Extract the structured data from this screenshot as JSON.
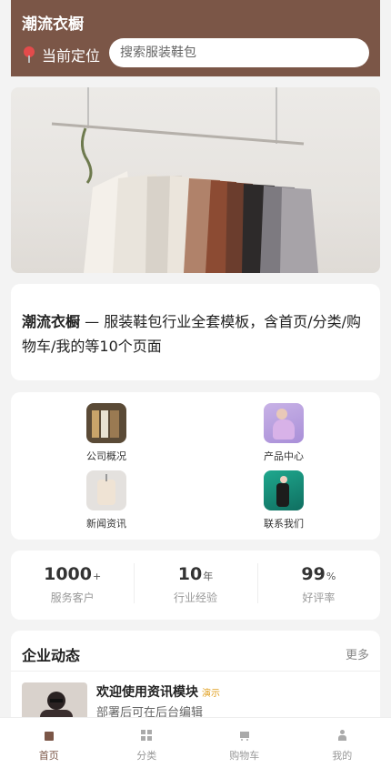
{
  "header": {
    "brand": "潮流衣橱",
    "location_label": "当前定位",
    "search_placeholder": "搜索服装鞋包"
  },
  "intro": {
    "brand": "潮流衣橱",
    "text": " — 服装鞋包行业全套模板，含首页/分类/购物车/我的等10个页面"
  },
  "grid": [
    {
      "label": "公司概况",
      "icon": "clothes-rack-icon"
    },
    {
      "label": "产品中心",
      "icon": "fashion-model-icon"
    },
    {
      "label": "新闻资讯",
      "icon": "blouse-icon"
    },
    {
      "label": "联系我们",
      "icon": "dancer-icon"
    }
  ],
  "stats": [
    {
      "value": "1000",
      "unit": "+",
      "label": "服务客户"
    },
    {
      "value": "10",
      "unit": "年",
      "label": "行业经验"
    },
    {
      "value": "99",
      "unit": "%",
      "label": "好评率"
    }
  ],
  "news": {
    "title": "企业动态",
    "more": "更多",
    "item": {
      "title": "欢迎使用资讯模块",
      "tag": "演示",
      "desc": "部署后可在后台编辑"
    }
  },
  "tabbar": [
    {
      "label": "首页",
      "active": true
    },
    {
      "label": "分类",
      "active": false
    },
    {
      "label": "购物车",
      "active": false
    },
    {
      "label": "我的",
      "active": false
    }
  ],
  "colors": {
    "brand": "#7b5647",
    "background": "#f3f3f3",
    "tag": "#e0a020"
  }
}
